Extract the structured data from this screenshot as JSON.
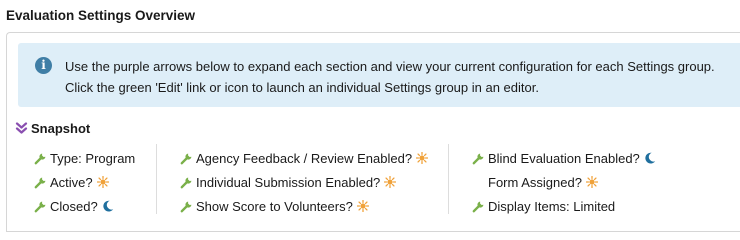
{
  "page": {
    "title": "Evaluation Settings Overview"
  },
  "info": {
    "icon": "info-icon",
    "line1": "Use the purple arrows below to expand each section and view your current configuration for each Settings group.",
    "line2": "Click the green 'Edit' link or icon to launch an individual Settings group in an editor."
  },
  "snapshot": {
    "title": "Snapshot",
    "columns": [
      [
        {
          "label": "Type: Program",
          "edit_icon": true,
          "status": null
        },
        {
          "label": "Active?",
          "edit_icon": true,
          "status": "sun"
        },
        {
          "label": "Closed?",
          "edit_icon": true,
          "status": "moon"
        }
      ],
      [
        {
          "label": "Agency Feedback / Review Enabled?",
          "edit_icon": true,
          "status": "sun"
        },
        {
          "label": "Individual Submission Enabled?",
          "edit_icon": true,
          "status": "sun"
        },
        {
          "label": "Show Score to Volunteers?",
          "edit_icon": true,
          "status": "sun"
        }
      ],
      [
        {
          "label": "Blind Evaluation Enabled?",
          "edit_icon": true,
          "status": "moon"
        },
        {
          "label": "Form Assigned?",
          "edit_icon": false,
          "status": "sun"
        },
        {
          "label": "Display Items: Limited",
          "edit_icon": true,
          "status": null
        }
      ]
    ]
  },
  "colors": {
    "accent_purple": "#8a4fb0",
    "edit_green": "#7ab04a",
    "sun_orange": "#f0a23a",
    "moon_blue": "#1f6f9e",
    "info_bg": "#deeef8",
    "info_icon": "#3f7ea6"
  }
}
